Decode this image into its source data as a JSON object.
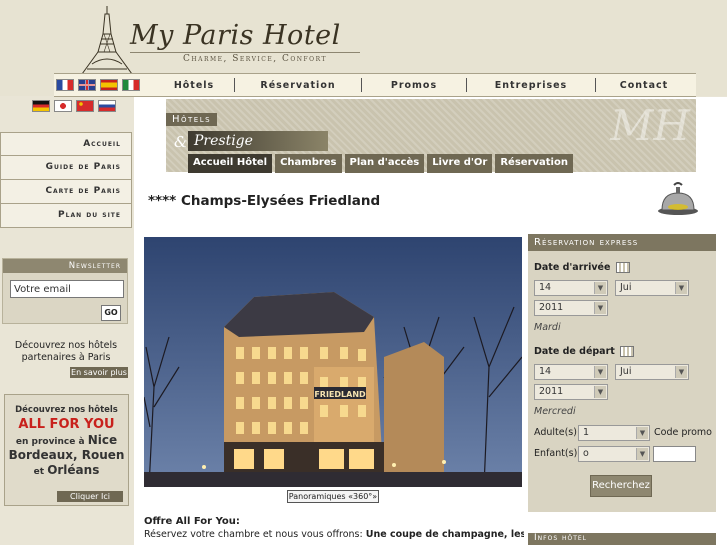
{
  "brand": {
    "name": "My Paris Hotel",
    "tagline": "Charme, Service, Confort"
  },
  "nav": {
    "items": [
      "Hôtels",
      "Réservation",
      "Promos",
      "Entreprises",
      "Contact"
    ]
  },
  "flags": {
    "top": [
      "fr",
      "gb",
      "es",
      "it"
    ],
    "bottom": [
      "de",
      "jp",
      "cn",
      "ru"
    ]
  },
  "sidebar": {
    "items": [
      "Accueil",
      "Guide de Paris",
      "Carte de Paris",
      "Plan du site"
    ]
  },
  "newsletter": {
    "title": "Newsletter",
    "input_value": "Votre email",
    "go_label": "GO"
  },
  "partners": {
    "text": "Découvrez nos hôtels partenaires à Paris",
    "button": "En savoir plus"
  },
  "promo_box": {
    "line1": "Découvrez nos hôtels",
    "line2": "ALL FOR YOU",
    "line3a": "en province à",
    "line3b": "Nice",
    "line4": "Bordeaux, Rouen",
    "line5a": "et",
    "line5b": "Orléans",
    "button": "Cliquer Ici"
  },
  "banner": {
    "hotels": "Hôtels",
    "amp": "&",
    "prestige": "Prestige",
    "monogram": "MH"
  },
  "tabs": [
    "Accueil Hôtel",
    "Chambres",
    "Plan d'accès",
    "Livre d'Or",
    "Réservation"
  ],
  "hotel": {
    "title": "**** Champs-Elysées Friedland",
    "panoramic_button": "Panoramiques «360°»",
    "photo_sign": "FRIEDLAND"
  },
  "offer": {
    "title": "Offre All For You:",
    "text_plain": "Réservez votre chambre et nous vous offrons: ",
    "text_bold": "Une coupe de champagne, les petits"
  },
  "reservation": {
    "title": "Réservation express",
    "arrival_label": "Date d'arrivée",
    "arrival_day": "14",
    "arrival_month": "Jui",
    "arrival_year": "2011",
    "arrival_weekday": "Mardi",
    "departure_label": "Date de départ",
    "departure_day": "14",
    "departure_month": "Jui",
    "departure_year": "2011",
    "departure_weekday": "Mercredi",
    "adults_label": "Adulte(s)",
    "adults_value": "1",
    "code_promo_label": "Code promo",
    "children_label": "Enfant(s)",
    "children_value": "o",
    "search_button": "Recherchez"
  },
  "info_hotel": {
    "title": "Infos hôtel"
  },
  "colors": {
    "accent": "#6f6853",
    "background": "#e9e5d6",
    "promo_red": "#c8211c"
  }
}
